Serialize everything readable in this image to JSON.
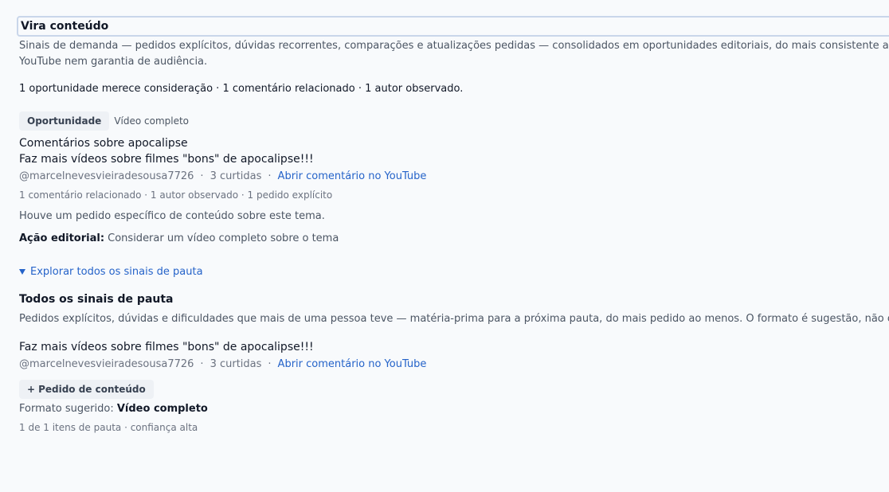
{
  "section": {
    "title": "Vira conteúdo",
    "description_line1": "Sinais de demanda — pedidos explícitos, dúvidas recorrentes, comparações e atualizações pedidas — consolidados em oportunidades editoriais, do mais consistente ao menos.",
    "description_line2": "YouTube nem garantia de audiência.",
    "summary": "1 oportunidade merece consideração · 1 comentário relacionado · 1 autor observado."
  },
  "opportunity": {
    "tag": "Oportunidade",
    "tag_sub": "Vídeo completo",
    "title": "Comentários sobre apocalipse",
    "comment": "Faz mais vídeos sobre filmes \"bons\" de apocalipse!!!",
    "author": "@marcelnevesvieiradesousa7726",
    "separator": "·",
    "likes": "3 curtidas",
    "link": "Abrir comentário no YouTube",
    "stats": "1 comentário relacionado · 1 autor observado · 1 pedido explícito",
    "note": "Houve um pedido específico de conteúdo sobre este tema.",
    "action_label": "Ação editorial:",
    "action_text": "Considerar um vídeo completo sobre o tema"
  },
  "explore": {
    "toggle_label": "Explorar todos os sinais de pauta",
    "icon": "triangle-down-icon"
  },
  "signals": {
    "title": "Todos os sinais de pauta",
    "description": "Pedidos explícitos, dúvidas e dificuldades que mais de uma pessoa teve — matéria-prima para a próxima pauta, do mais pedido ao menos. O formato é sugestão, não obrigação.",
    "item": {
      "comment": "Faz mais vídeos sobre filmes \"bons\" de apocalipse!!!",
      "author": "@marcelnevesvieiradesousa7726",
      "separator": "·",
      "likes": "3 curtidas",
      "link": "Abrir comentário no YouTube",
      "pill_plus": "+",
      "pill_label": "Pedido de conteúdo",
      "format_label": "Formato sugerido:",
      "format_value": "Vídeo completo"
    },
    "footer": "1 de 1 itens de pauta · confiança alta"
  },
  "colors": {
    "background": "#f8fafc",
    "link": "#2563c9",
    "header_border": "#c9d6ea",
    "tag_bg": "#eef1f5"
  }
}
